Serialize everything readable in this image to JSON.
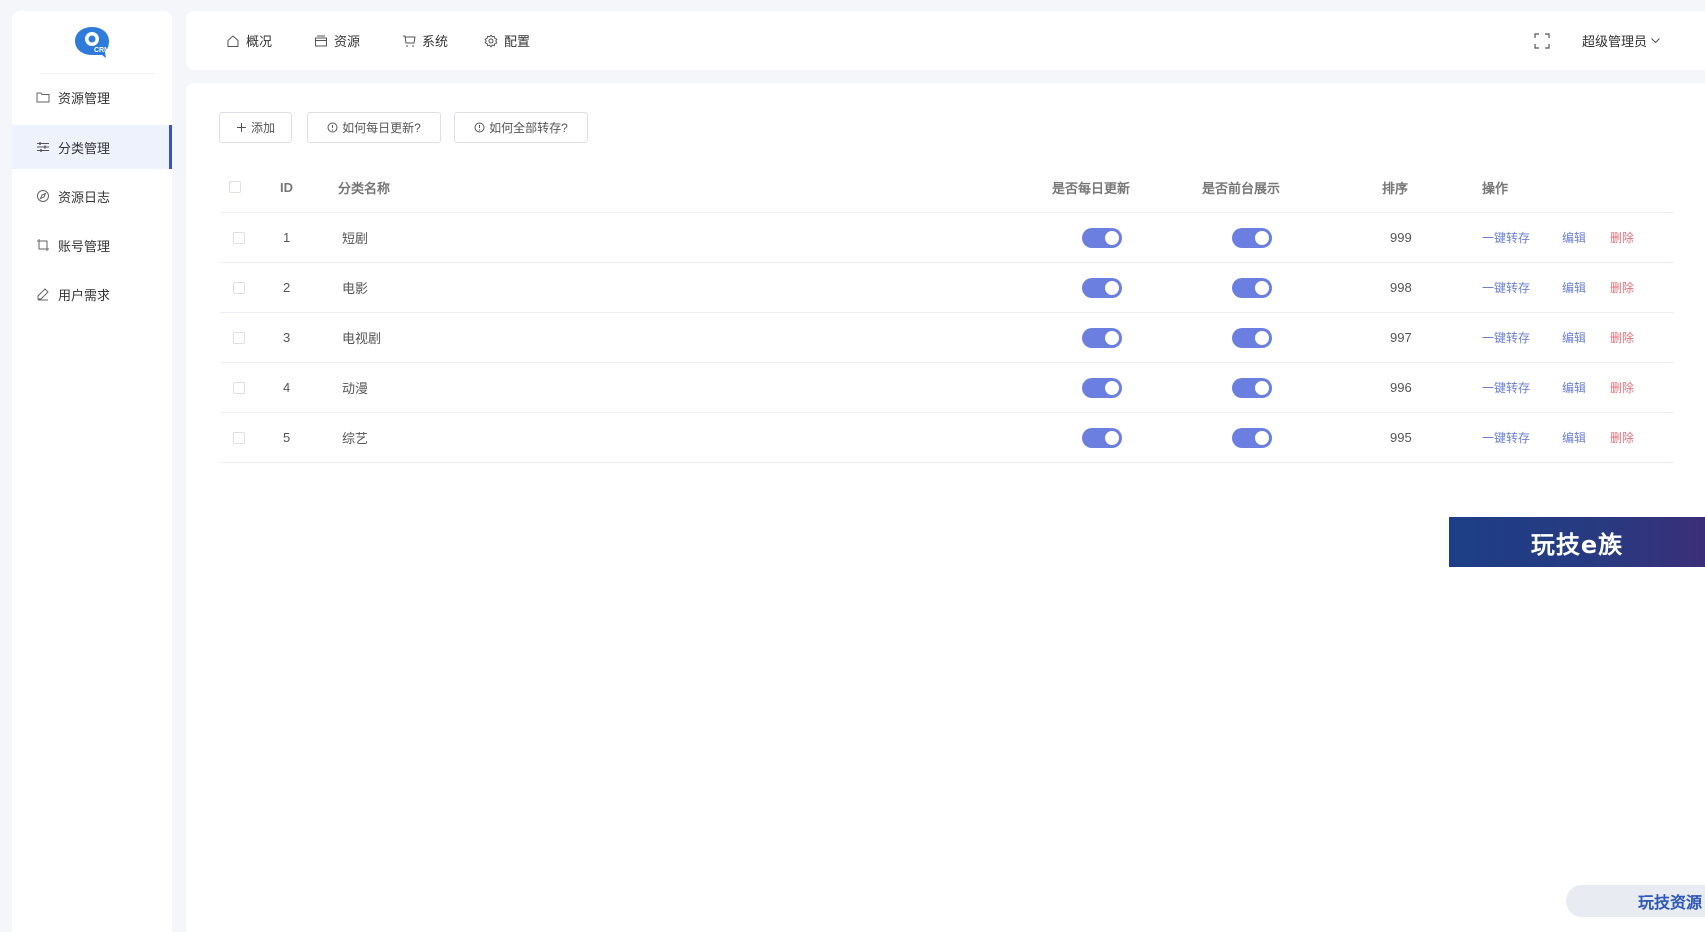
{
  "logo": {
    "text": "CRM",
    "color": "#2f7bd9"
  },
  "sidebar": {
    "items": [
      {
        "label": "资源管理",
        "icon": "folder-icon",
        "active": false
      },
      {
        "label": "分类管理",
        "icon": "sliders-icon",
        "active": true
      },
      {
        "label": "资源日志",
        "icon": "compass-icon",
        "active": false
      },
      {
        "label": "账号管理",
        "icon": "crop-icon",
        "active": false
      },
      {
        "label": "用户需求",
        "icon": "pen-icon",
        "active": false
      }
    ]
  },
  "topnav": {
    "items": [
      {
        "label": "概况",
        "icon": "home-icon"
      },
      {
        "label": "资源",
        "icon": "box-icon"
      },
      {
        "label": "系统",
        "icon": "cart-icon"
      },
      {
        "label": "配置",
        "icon": "gear-icon"
      }
    ],
    "user": "超级管理员"
  },
  "toolbar": {
    "add": "添加",
    "daily_help": "如何每日更新?",
    "transfer_help": "如何全部转存?"
  },
  "table": {
    "columns": {
      "id": "ID",
      "name": "分类名称",
      "daily": "是否每日更新",
      "front": "是否前台展示",
      "sort": "排序",
      "ops": "操作"
    },
    "rows": [
      {
        "id": "1",
        "name": "短剧",
        "daily": true,
        "front": true,
        "sort": "999"
      },
      {
        "id": "2",
        "name": "电影",
        "daily": true,
        "front": true,
        "sort": "998"
      },
      {
        "id": "3",
        "name": "电视剧",
        "daily": true,
        "front": true,
        "sort": "997"
      },
      {
        "id": "4",
        "name": "动漫",
        "daily": true,
        "front": true,
        "sort": "996"
      },
      {
        "id": "5",
        "name": "综艺",
        "daily": true,
        "front": true,
        "sort": "995"
      }
    ],
    "ops": {
      "transfer": "一键转存",
      "edit": "编辑",
      "delete": "删除"
    }
  },
  "banner": {
    "text": "玩技e族"
  },
  "watermark": {
    "text": "玩技资源"
  },
  "colors": {
    "accent": "#3d55b8",
    "switch_on": "#6b7fe0",
    "link": "#6b7fd0",
    "danger": "#e0707a"
  }
}
